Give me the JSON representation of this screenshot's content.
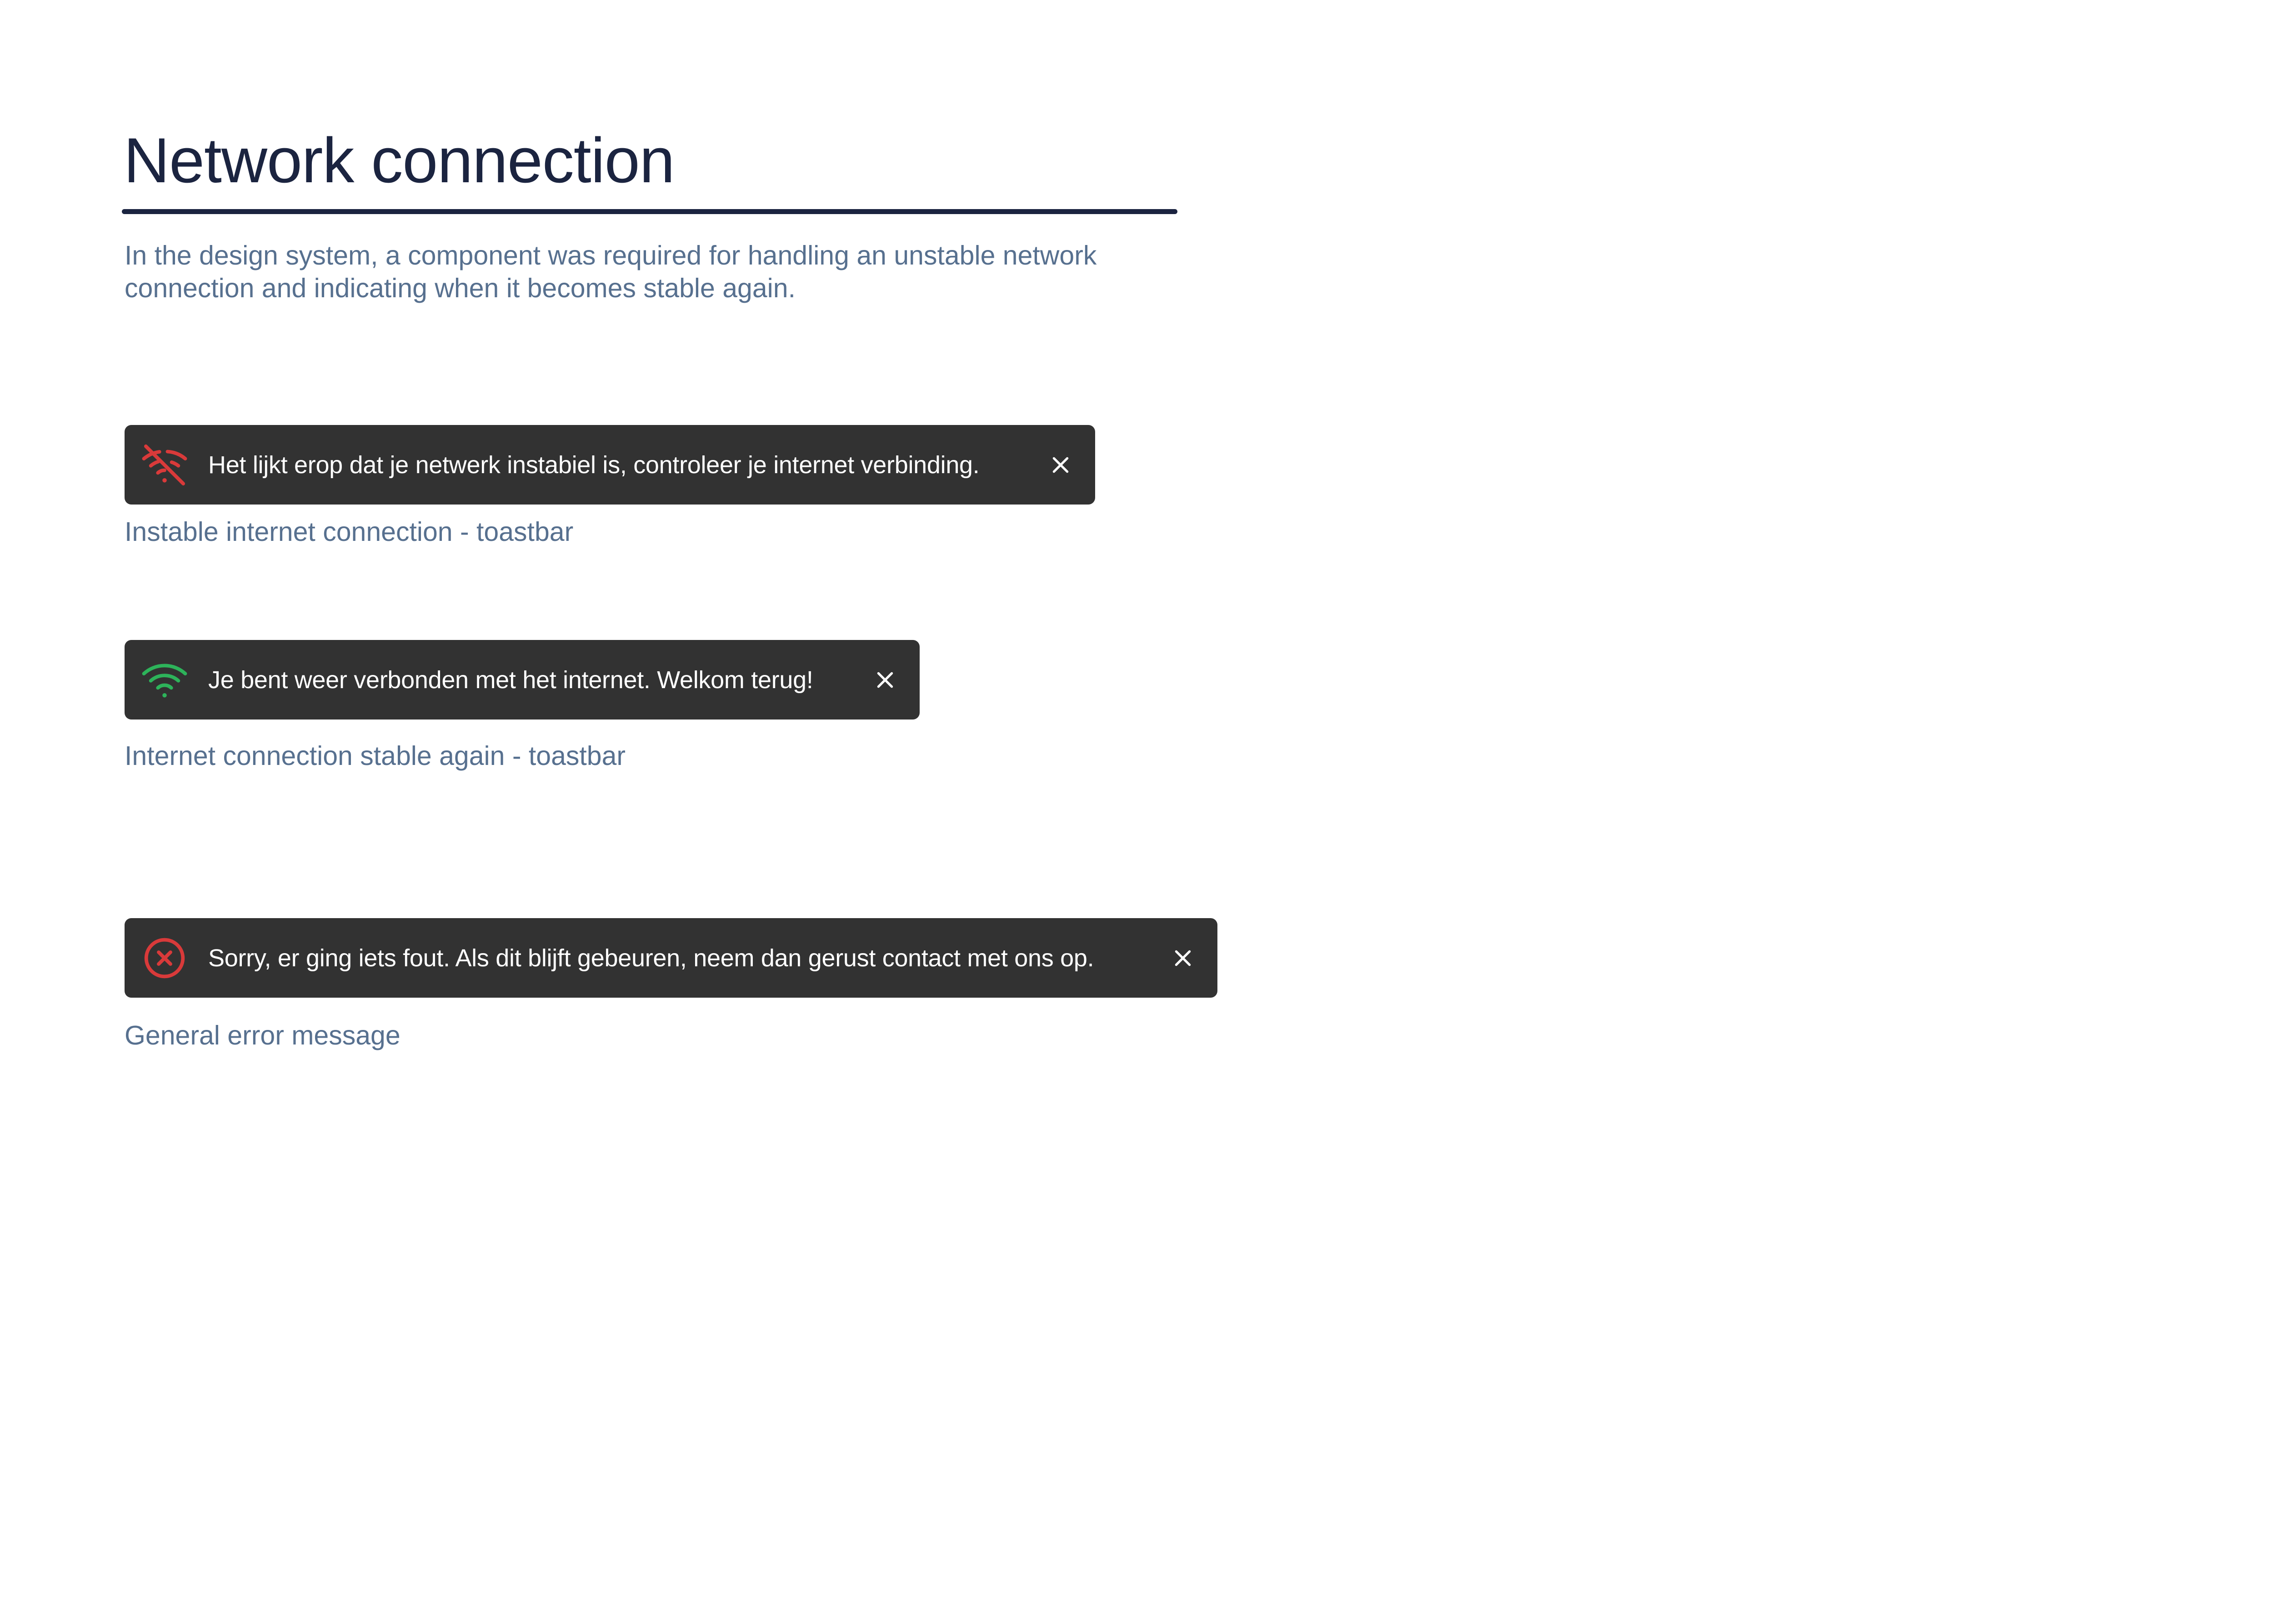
{
  "page": {
    "title": "Network connection",
    "intro": "In the design system, a component was required for handling an unstable network connection and indicating when it becomes stable again."
  },
  "toasts": [
    {
      "icon": "wifi-off-icon",
      "icon_color": "#d93a3a",
      "message": "Het lijkt erop dat je netwerk instabiel is, controleer je internet verbinding.",
      "close_icon": "close-icon",
      "caption": "Instable internet connection - toastbar"
    },
    {
      "icon": "wifi-icon",
      "icon_color": "#2db35a",
      "message": "Je bent weer verbonden met het internet. Welkom terug!",
      "close_icon": "close-icon",
      "caption": "Internet connection stable again - toastbar"
    },
    {
      "icon": "error-circle-icon",
      "icon_color": "#d93a3a",
      "message": "Sorry, er ging iets fout. Als dit blijft gebeuren, neem dan gerust contact met ons op.",
      "close_icon": "close-icon",
      "caption": "General error message"
    }
  ],
  "colors": {
    "heading": "#1b2440",
    "body_text": "#57708f",
    "toast_background": "#323232",
    "toast_text": "#ffffff"
  }
}
